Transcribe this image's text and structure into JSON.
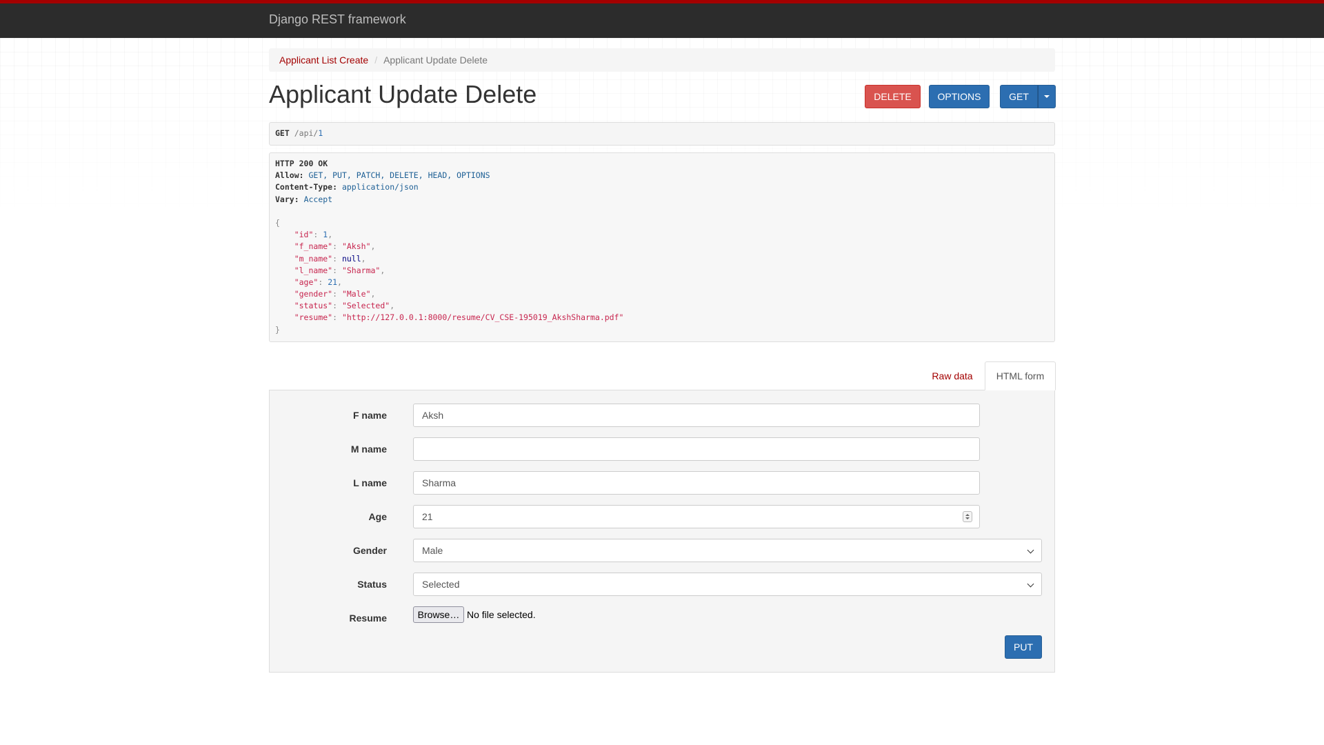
{
  "navbar": {
    "brand": "Django REST framework"
  },
  "breadcrumb": {
    "items": [
      "Applicant List Create",
      "Applicant Update Delete"
    ],
    "separator": "/"
  },
  "page": {
    "title": "Applicant Update Delete"
  },
  "actions": {
    "delete_label": "DELETE",
    "options_label": "OPTIONS",
    "get_label": "GET"
  },
  "request": {
    "method": "GET",
    "path": "/api/",
    "id": "1"
  },
  "response": {
    "status": "HTTP 200 OK",
    "headers": [
      {
        "key": "Allow:",
        "value": "GET, PUT, PATCH, DELETE, HEAD, OPTIONS"
      },
      {
        "key": "Content-Type:",
        "value": "application/json"
      },
      {
        "key": "Vary:",
        "value": "Accept"
      }
    ],
    "json_open": "{",
    "json_close": "}",
    "json": [
      {
        "key": "\"id\"",
        "value": "1"
      },
      {
        "key": "\"f_name\"",
        "value": "\"Aksh\""
      },
      {
        "key": "\"m_name\"",
        "value": "null"
      },
      {
        "key": "\"l_name\"",
        "value": "\"Sharma\""
      },
      {
        "key": "\"age\"",
        "value": "21"
      },
      {
        "key": "\"gender\"",
        "value": "\"Male\""
      },
      {
        "key": "\"status\"",
        "value": "\"Selected\""
      },
      {
        "key": "\"resume\"",
        "value": "\"http://127.0.0.1:8000/resume/CV_CSE-195019_AkshSharma.pdf\""
      }
    ]
  },
  "tabs": {
    "raw": "Raw data",
    "html": "HTML form"
  },
  "form": {
    "f_name": {
      "label": "F name",
      "value": "Aksh"
    },
    "m_name": {
      "label": "M name",
      "value": ""
    },
    "l_name": {
      "label": "L name",
      "value": "Sharma"
    },
    "age": {
      "label": "Age",
      "value": "21"
    },
    "gender": {
      "label": "Gender",
      "value": "Male"
    },
    "status": {
      "label": "Status",
      "value": "Selected"
    },
    "resume": {
      "label": "Resume",
      "browse": "Browse…",
      "file_status": "No file selected."
    },
    "submit_label": "PUT"
  },
  "colors": {
    "brand_red": "#a30000",
    "primary": "#2c6eb1",
    "danger": "#d9534f",
    "navbar": "#2c2c2c"
  }
}
